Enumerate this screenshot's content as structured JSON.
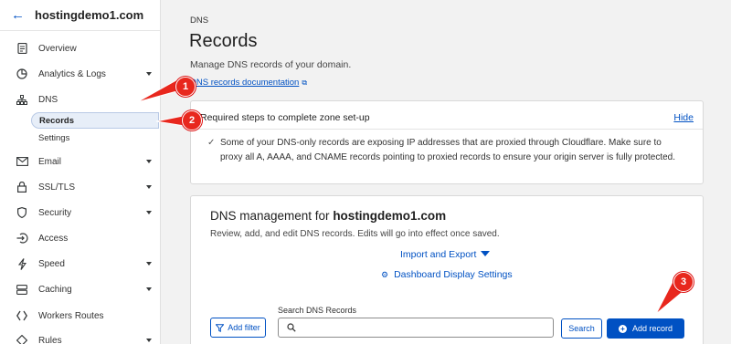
{
  "account": {
    "back_icon": "arrow-left-icon",
    "name": "hostingdemo1.com"
  },
  "sidebar": {
    "items": [
      {
        "label": "Overview",
        "icon": "document-icon",
        "caret": false
      },
      {
        "label": "Analytics & Logs",
        "icon": "pie-chart-icon",
        "caret": true
      },
      {
        "label": "DNS",
        "icon": "network-icon",
        "caret": false
      },
      {
        "label": "Email",
        "icon": "envelope-icon",
        "caret": true
      },
      {
        "label": "SSL/TLS",
        "icon": "lock-icon",
        "caret": true
      },
      {
        "label": "Security",
        "icon": "shield-icon",
        "caret": true
      },
      {
        "label": "Access",
        "icon": "access-icon",
        "caret": false
      },
      {
        "label": "Speed",
        "icon": "lightning-icon",
        "caret": true
      },
      {
        "label": "Caching",
        "icon": "server-icon",
        "caret": true
      },
      {
        "label": "Workers Routes",
        "icon": "workers-icon",
        "caret": false
      },
      {
        "label": "Rules",
        "icon": "rules-icon",
        "caret": true
      }
    ],
    "dns_subitems": [
      {
        "label": "Records",
        "active": true
      },
      {
        "label": "Settings",
        "active": false
      }
    ]
  },
  "page": {
    "breadcrumb": "DNS",
    "title": "Records",
    "subtitle": "Manage DNS records of your domain.",
    "doc_link": "DNS records documentation"
  },
  "setup_card": {
    "heading": "Required steps to complete zone set-up",
    "hide_label": "Hide",
    "message": "Some of your DNS-only records are exposing IP addresses that are proxied through Cloudflare. Make sure to proxy all A, AAAA, and CNAME records pointing to proxied records to ensure your origin server is fully protected."
  },
  "dns_card": {
    "heading_prefix": "DNS management for ",
    "heading_domain": "hostingdemo1.com",
    "description": "Review, add, and edit DNS records. Edits will go into effect once saved.",
    "import_export": "Import and Export",
    "dashboard_settings": "Dashboard Display Settings",
    "search_label": "Search DNS Records",
    "search_value": "",
    "add_filter": "Add filter",
    "search_button": "Search",
    "add_record": "Add record"
  },
  "annotations": [
    {
      "number": "1"
    },
    {
      "number": "2"
    },
    {
      "number": "3"
    }
  ],
  "colors": {
    "accent": "#0051c3",
    "annotation": "#e8271d",
    "active_bg": "#e7eef8"
  }
}
